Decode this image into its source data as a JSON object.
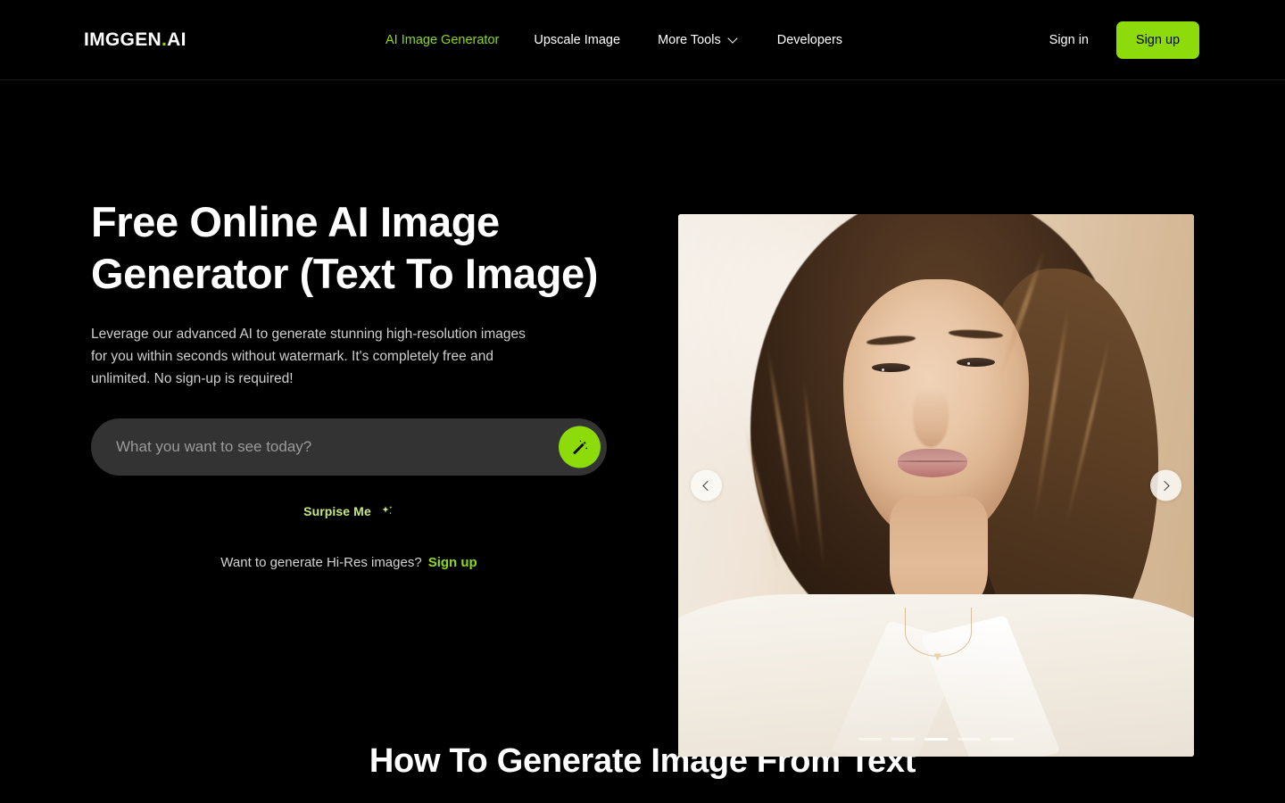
{
  "brand": {
    "name_main": "IMGGEN",
    "dot": ".",
    "name_suffix": "AI",
    "accent_green": "#8ddb0b",
    "pale_green": "#c7e87c",
    "background": "#000000",
    "input_bg": "#333333"
  },
  "header": {
    "nav": [
      {
        "label": "AI Image Generator",
        "active": true
      },
      {
        "label": "Upscale Image",
        "active": false
      },
      {
        "label": "More Tools",
        "active": false,
        "has_chevron": true
      },
      {
        "label": "Developers",
        "active": false
      }
    ],
    "sign_in_label": "Sign in",
    "sign_up_label": "Sign up",
    "chevron_icon": "chevron-down-icon"
  },
  "hero": {
    "title": "Free Online AI Image Generator (Text To Image)",
    "subtitle": "Leverage our advanced AI to generate stunning high-resolution images for you within seconds without watermark. It's completely free and unlimited. No sign-up is required!",
    "prompt": {
      "value": "",
      "placeholder": "What you want to see today?",
      "generate_icon": "magic-wand-icon"
    },
    "surprise": {
      "label": "Surpise Me",
      "icon": "sparkles-icon"
    },
    "hires": {
      "text": "Want to generate Hi-Res images?",
      "link_label": "Sign up"
    }
  },
  "carousel": {
    "prev_icon": "chevron-left-icon",
    "next_icon": "chevron-right-icon",
    "slide_count": 5,
    "active_slide": 3,
    "image_alt": "Portrait of a young woman with wavy brown hair wearing a white blouse against a beige backdrop"
  },
  "section": {
    "heading": "How To Generate Image From Text"
  }
}
